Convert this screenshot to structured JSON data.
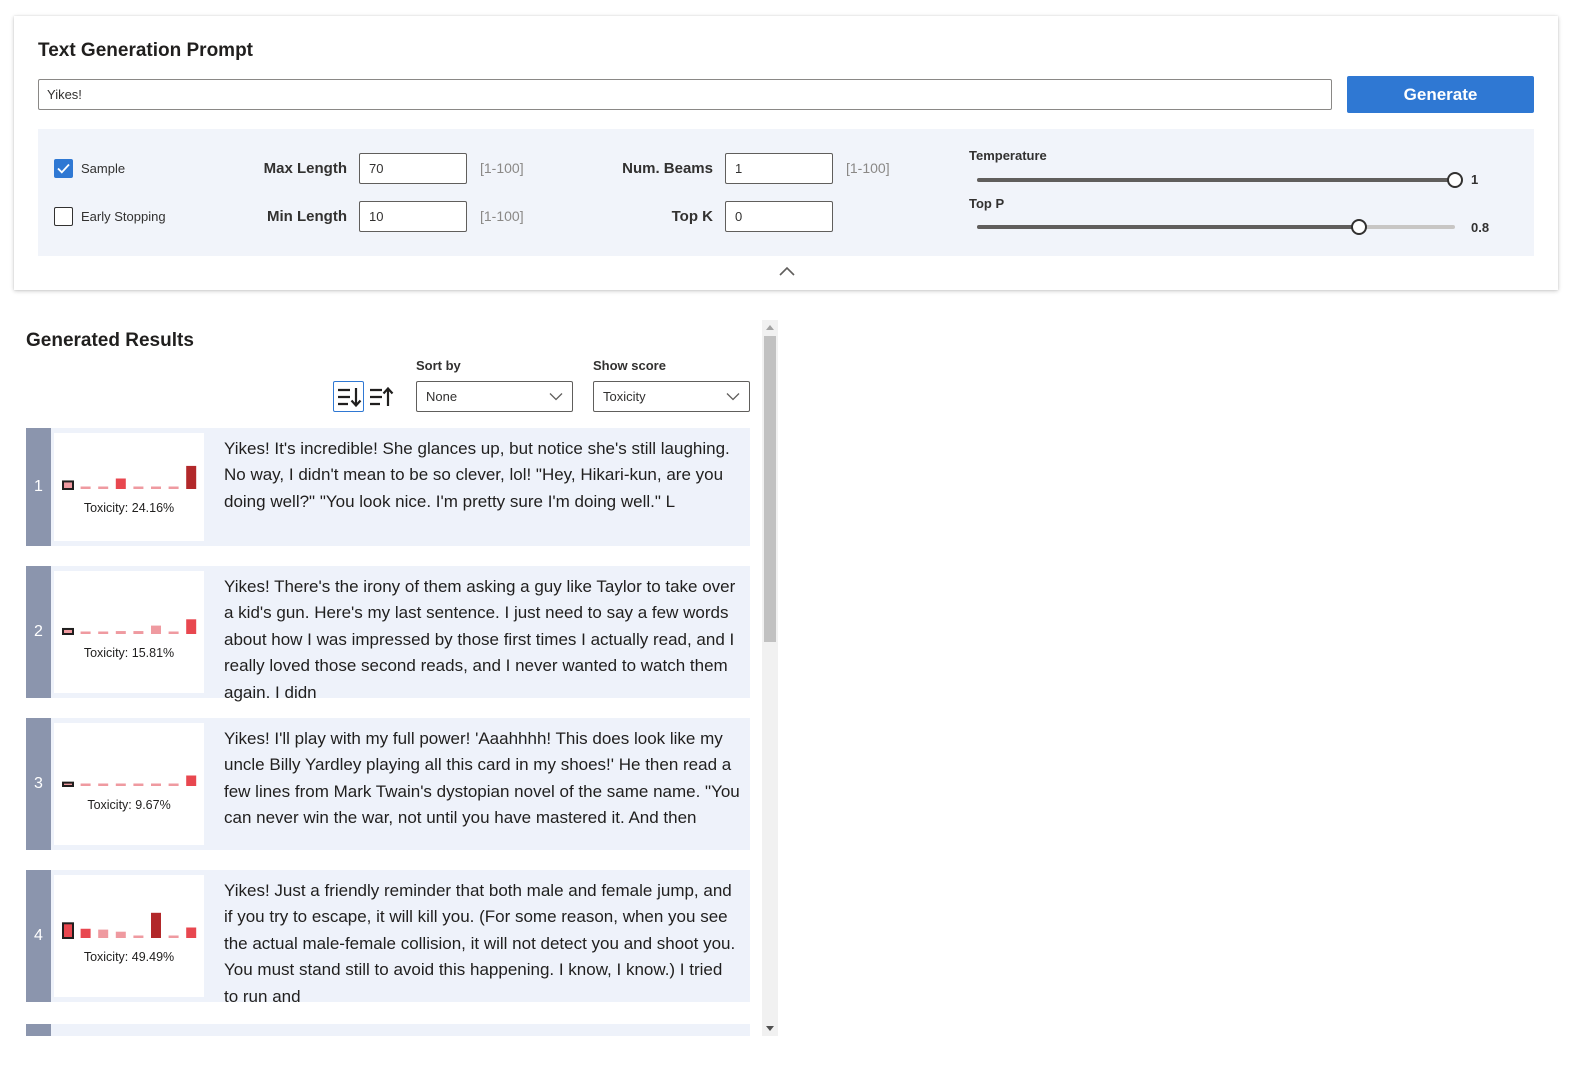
{
  "prompt": {
    "title": "Text Generation Prompt",
    "input_value": "Yikes!",
    "generate_label": "Generate"
  },
  "options": {
    "sample_label": "Sample",
    "sample_checked": true,
    "early_stopping_label": "Early Stopping",
    "early_stopping_checked": false,
    "max_length_label": "Max Length",
    "max_length_value": "70",
    "max_length_range": "[1-100]",
    "min_length_label": "Min Length",
    "min_length_value": "10",
    "min_length_range": "[1-100]",
    "num_beams_label": "Num. Beams",
    "num_beams_value": "1",
    "num_beams_range": "[1-100]",
    "top_k_label": "Top K",
    "top_k_value": "0",
    "temperature_label": "Temperature",
    "temperature_value": "1",
    "temperature_fraction": 1.0,
    "top_p_label": "Top P",
    "top_p_value": "0.8",
    "top_p_fraction": 0.8
  },
  "results_header": {
    "title": "Generated Results",
    "sort_by_label": "Sort by",
    "sort_by_value": "None",
    "show_score_label": "Show score",
    "show_score_value": "Toxicity"
  },
  "colors": {
    "accent": "#2f78d3",
    "index_bar": "#8b95ad",
    "card_bg": "#eef2fa",
    "bar_low": "#ef9aa0",
    "bar_mid": "#e8474f",
    "bar_high": "#b2282a"
  },
  "results": [
    {
      "index": "1",
      "score_label": "Toxicity: 24.16%",
      "bars": [
        0.18,
        0.03,
        0.03,
        0.25,
        0.03,
        0.03,
        0.03,
        0.55
      ],
      "text": "Yikes! It's incredible! She glances up, but notice she's still laughing. No way, I didn't mean to be so clever, lol! \"Hey, Hikari-kun, are you doing well?\" \"You look nice. I'm pretty sure I'm doing well.\" L"
    },
    {
      "index": "2",
      "score_label": "Toxicity: 15.81%",
      "bars": [
        0.12,
        0.03,
        0.03,
        0.07,
        0.07,
        0.2,
        0.03,
        0.35
      ],
      "text": "Yikes! There's the irony of them asking a guy like Taylor to take over a kid's gun. Here's my last sentence. I just need to say a few words about how I was impressed by those first times I actually read, and I really loved those second reads, and I never wanted to watch them again. I didn"
    },
    {
      "index": "3",
      "score_label": "Toxicity: 9.67%",
      "bars": [
        0.08,
        0.02,
        0.02,
        0.02,
        0.02,
        0.02,
        0.02,
        0.25
      ],
      "text": "Yikes! I'll play with my full power! 'Aaahhhh! This does look like my uncle Billy Yardley playing all this card in my shoes!' He then read a few lines from Mark Twain's dystopian novel of the same name. \"You can never win the war, not until you have mastered it. And then"
    },
    {
      "index": "4",
      "score_label": "Toxicity: 49.49%",
      "bars": [
        0.35,
        0.22,
        0.2,
        0.15,
        0.05,
        0.6,
        0.03,
        0.25
      ],
      "text": "Yikes! Just a friendly reminder that both male and female jump, and if you try to escape, it will kill you. (For some reason, when you see the actual male-female collision, it will not detect you and shoot you. You must stand still to avoid this happening. I know, I know.) I tried to run and"
    }
  ]
}
